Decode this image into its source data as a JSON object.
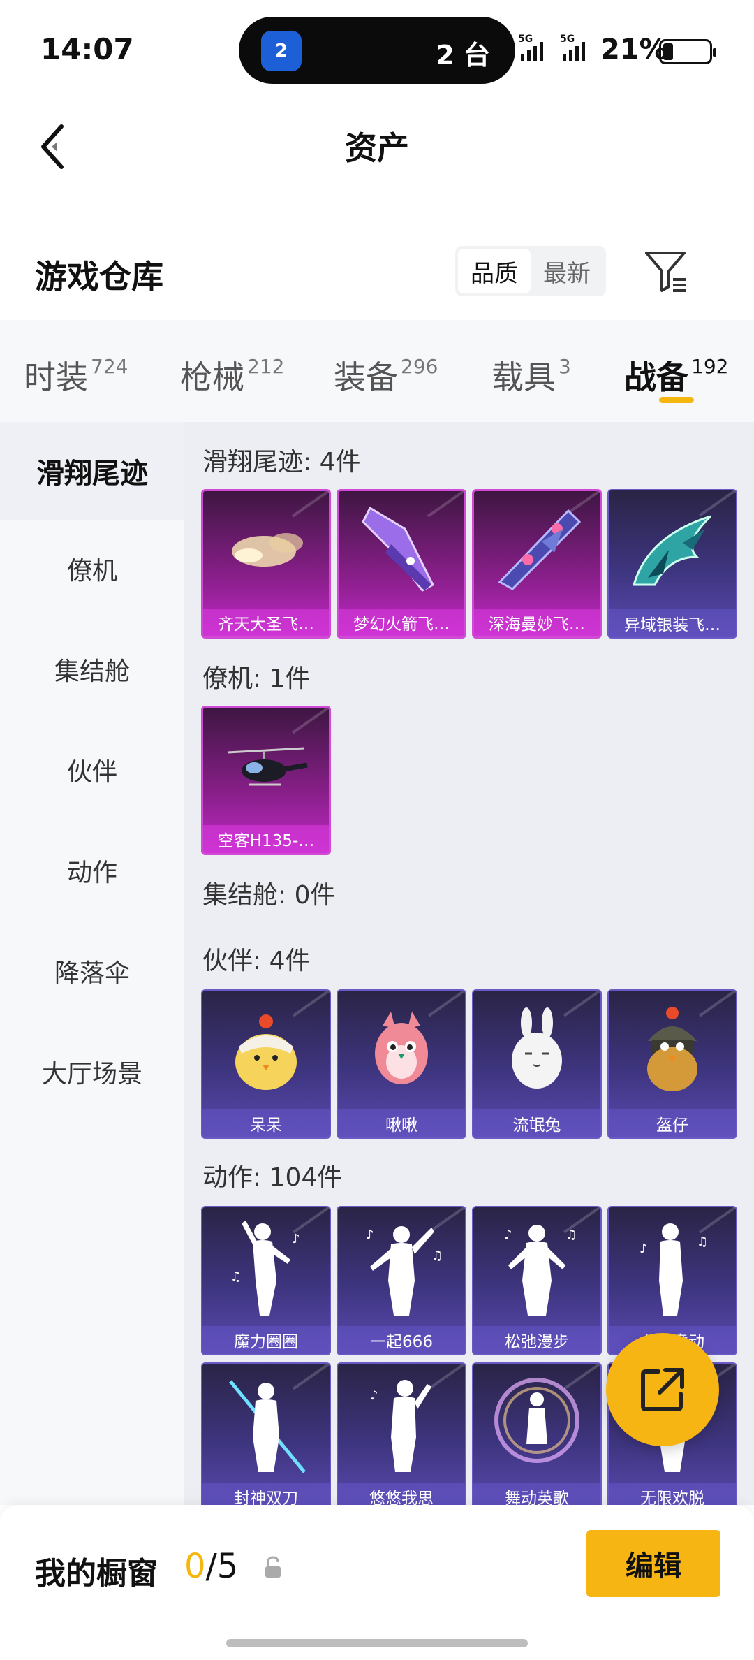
{
  "status_bar": {
    "time": "14:07",
    "pill_icon_badge": "2",
    "pill_text": "2 台",
    "network_1": "5G",
    "network_2": "5G",
    "battery": "21%"
  },
  "nav": {
    "title": "资产"
  },
  "header": {
    "title": "游戏仓库",
    "sort_options": [
      "品质",
      "最新"
    ],
    "sort_selected": "品质"
  },
  "tabs": [
    {
      "label": "时装",
      "count": "724"
    },
    {
      "label": "枪械",
      "count": "212"
    },
    {
      "label": "装备",
      "count": "296"
    },
    {
      "label": "载具",
      "count": "3"
    },
    {
      "label": "战备",
      "count": "192",
      "active": true
    }
  ],
  "sidebar": {
    "items": [
      "滑翔尾迹",
      "僚机",
      "集结舱",
      "伙伴",
      "动作",
      "降落伞",
      "大厅场景"
    ],
    "active": "滑翔尾迹"
  },
  "groups": {
    "glide": {
      "label": "滑翔尾迹: 4件",
      "items": [
        "齐天大圣飞…",
        "梦幻火箭飞…",
        "深海曼妙飞…",
        "异域银装飞…"
      ]
    },
    "wingman": {
      "label": "僚机: 1件",
      "items": [
        "空客H135-…"
      ]
    },
    "capsule": {
      "label": "集结舱: 0件"
    },
    "companion": {
      "label": "伙伴: 4件",
      "items": [
        "呆呆",
        "啾啾",
        "流氓兔",
        "盔仔"
      ]
    },
    "emote": {
      "label": "动作: 104件",
      "items": [
        "魔力圈圈",
        "一起666",
        "松弛漫步",
        "心随意动",
        "封神双刀",
        "悠悠我思",
        "舞动英歌",
        "无限欢脱"
      ]
    }
  },
  "bottom": {
    "showcase_label": "我的橱窗",
    "showcase_current": "0",
    "showcase_total": "/5",
    "edit_label": "编辑"
  },
  "colors": {
    "accent": "#f6b512",
    "pink_card": "#c02ac6",
    "blue_card": "#5a4ab0"
  }
}
